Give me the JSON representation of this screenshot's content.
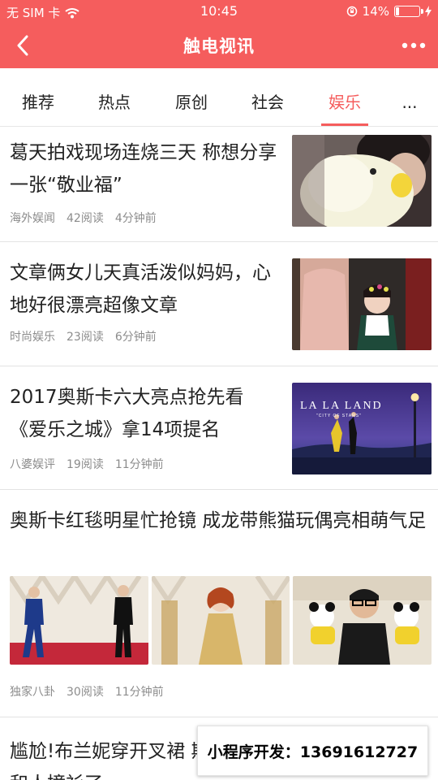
{
  "status_bar": {
    "carrier": "无 SIM 卡",
    "time": "10:45",
    "battery_percent": "14%",
    "battery_level": 0.14
  },
  "nav": {
    "title": "触电视讯",
    "back_icon": "chevron-left-icon",
    "more_icon": "more-dots-icon"
  },
  "tabs": [
    {
      "label": "推荐",
      "active": false
    },
    {
      "label": "热点",
      "active": false
    },
    {
      "label": "原创",
      "active": false
    },
    {
      "label": "社会",
      "active": false
    },
    {
      "label": "娱乐",
      "active": true
    },
    {
      "label": "...",
      "active": false
    }
  ],
  "colors": {
    "accent": "#f55d5d",
    "meta_text": "#8c8c8c"
  },
  "articles": [
    {
      "title": "葛天拍戏现场连烧三天 称想分享一张“敬业福”",
      "source": "海外娱闻",
      "reads": "42阅读",
      "time": "4分钟前"
    },
    {
      "title": "文章俩女儿天真活泼似妈妈，心地好很漂亮超像文章",
      "source": "时尚娱乐",
      "reads": "23阅读",
      "time": "6分钟前"
    },
    {
      "title": "2017奥斯卡六大亮点抢先看《爱乐之城》拿14项提名",
      "source": "八婆娱评",
      "reads": "19阅读",
      "time": "11分钟前",
      "thumb_caption": "LA LA LAND",
      "thumb_subcaption": "\"CITY OF STARS\""
    },
    {
      "title": "奥斯卡红毯明星忙抢镜 成龙带熊猫玩偶亮相萌气足",
      "source": "独家八卦",
      "reads": "30阅读",
      "time": "11分钟前"
    },
    {
      "title": "尴尬!布兰妮穿开叉裙 斯卡红毯 和人撞衫了"
    }
  ],
  "watermark": "小程序开发：13691612727"
}
